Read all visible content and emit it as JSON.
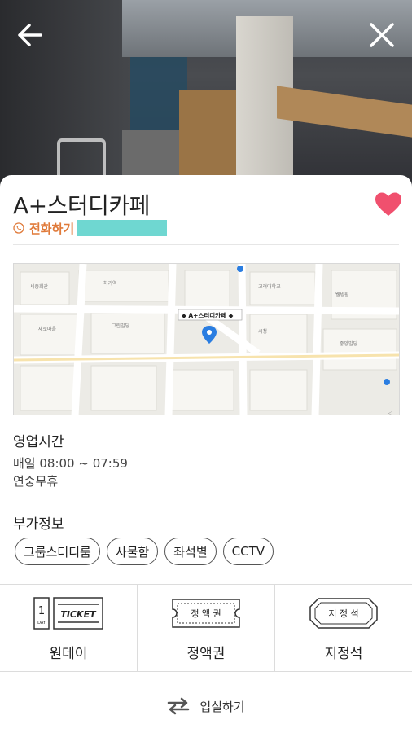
{
  "header": {
    "back_icon": "arrow-left-icon",
    "close_icon": "close-icon"
  },
  "place": {
    "name": "A+스터디카페",
    "call_label": "전화하기",
    "favorite_color": "#f0506e"
  },
  "map": {
    "marker_label": "A+스터디카페",
    "labels": [
      "세종회관",
      "하기역",
      "그린빌딩",
      "새로마을",
      "고려대학교",
      "웰빙원",
      "시청",
      "중앙빌딩"
    ]
  },
  "hours": {
    "title": "영업시간",
    "daily": "매일 08:00 ~ 07:59",
    "holiday": "연중무휴"
  },
  "extras": {
    "title": "부가정보",
    "chips": [
      "그룹스터디룸",
      "사물함",
      "좌석별",
      "CCTV"
    ]
  },
  "tickets": [
    {
      "label": "원데이",
      "art_text": "TICKET",
      "art_day": "1",
      "art_day_unit": "DAY"
    },
    {
      "label": "정액권",
      "art_text": "정 액 권"
    },
    {
      "label": "지정석",
      "art_text": "지 정 석"
    }
  ],
  "enter": {
    "label": "입실하기",
    "icon": "swap-arrows-icon"
  },
  "colors": {
    "accent": "#e07a3a",
    "heart": "#f0506e",
    "map_pin": "#2a7de1"
  }
}
